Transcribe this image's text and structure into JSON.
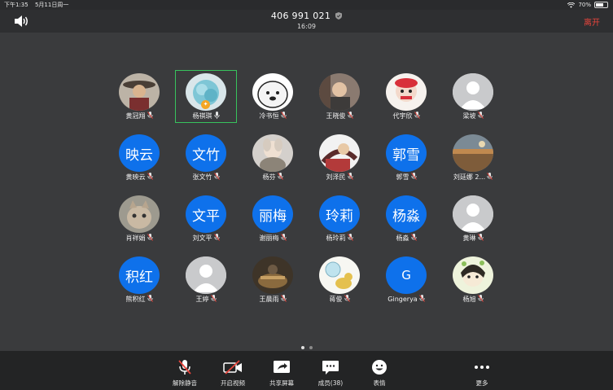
{
  "status_bar": {
    "time": "下午1:35",
    "date": "5月11日周一",
    "battery": "70%",
    "battery_level": 0.7
  },
  "header": {
    "meeting_id": "406 991 021",
    "elapsed": "16:09",
    "leave_label": "离开"
  },
  "participants": [
    {
      "name": "黄冠翔",
      "avatar": "photo"
    },
    {
      "name": "杨祺琪",
      "avatar": "photo",
      "active": true,
      "host": true
    },
    {
      "name": "冷书恒",
      "avatar": "photo"
    },
    {
      "name": "王晓俊",
      "avatar": "photo"
    },
    {
      "name": "代宇欣",
      "avatar": "photo"
    },
    {
      "name": "梁坡",
      "avatar": "default"
    },
    {
      "name": "黄映云",
      "avatar": "text",
      "avatar_text": "映云"
    },
    {
      "name": "张文竹",
      "avatar": "text",
      "avatar_text": "文竹"
    },
    {
      "name": "杨芬",
      "avatar": "photo"
    },
    {
      "name": "刘泽民",
      "avatar": "photo"
    },
    {
      "name": "郭雪",
      "avatar": "text",
      "avatar_text": "郭雪"
    },
    {
      "name": "刘廷娜 2...",
      "avatar": "photo"
    },
    {
      "name": "肖祥娟",
      "avatar": "photo"
    },
    {
      "name": "刘文平",
      "avatar": "text",
      "avatar_text": "文平"
    },
    {
      "name": "谢丽梅",
      "avatar": "text",
      "avatar_text": "丽梅"
    },
    {
      "name": "杨玲莉",
      "avatar": "text",
      "avatar_text": "玲莉"
    },
    {
      "name": "杨淼",
      "avatar": "text",
      "avatar_text": "杨淼"
    },
    {
      "name": "黄琳",
      "avatar": "default"
    },
    {
      "name": "熊积红",
      "avatar": "text",
      "avatar_text": "积红"
    },
    {
      "name": "王婷",
      "avatar": "default"
    },
    {
      "name": "王晨雨",
      "avatar": "photo"
    },
    {
      "name": "蒋俊",
      "avatar": "photo"
    },
    {
      "name": "Gingerya",
      "avatar": "letter",
      "avatar_text": "G"
    },
    {
      "name": "杨旭",
      "avatar": "photo"
    }
  ],
  "pager": {
    "pages": 2,
    "current": 1
  },
  "toolbar": {
    "unmute": "解除静音",
    "start_video": "开启视频",
    "share_screen": "共享屏幕",
    "participants": "成员(38)",
    "reactions": "表情",
    "more": "更多"
  },
  "colors": {
    "background": "#3a3b3d",
    "accent_blue": "#0e71eb",
    "leave_red": "#e8453c",
    "active_green": "#37c35d"
  }
}
